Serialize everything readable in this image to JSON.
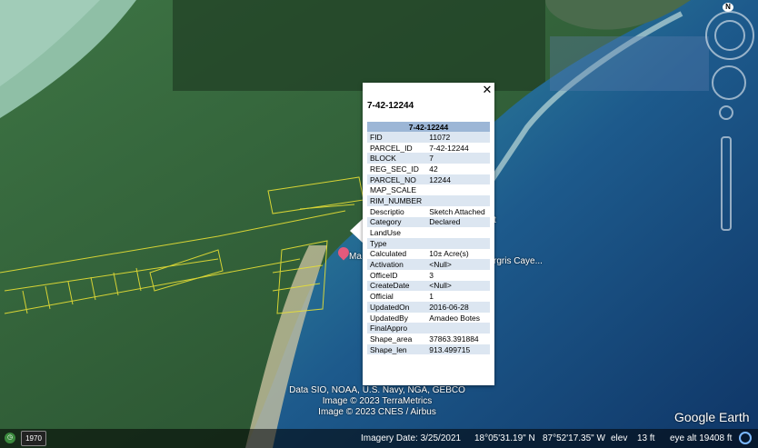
{
  "popup": {
    "title": "7-42-12244",
    "header": "7-42-12244",
    "rows": [
      {
        "key": "FID",
        "value": "11072"
      },
      {
        "key": "PARCEL_ID",
        "value": "7-42-12244"
      },
      {
        "key": "BLOCK",
        "value": "7"
      },
      {
        "key": "REG_SEC_ID",
        "value": "42"
      },
      {
        "key": "PARCEL_NO",
        "value": "12244"
      },
      {
        "key": "MAP_SCALE",
        "value": ""
      },
      {
        "key": "RIM_NUMBER",
        "value": ""
      },
      {
        "key": "Descriptio",
        "value": "Sketch Attached"
      },
      {
        "key": "Category",
        "value": "Declared"
      },
      {
        "key": "LandUse",
        "value": ""
      },
      {
        "key": "Type",
        "value": ""
      },
      {
        "key": "Calculated",
        "value": "10± Acre(s)"
      },
      {
        "key": "Activation",
        "value": "<Null>"
      },
      {
        "key": "OfficeID",
        "value": "3"
      },
      {
        "key": "CreateDate",
        "value": "<Null>"
      },
      {
        "key": "Official",
        "value": "1"
      },
      {
        "key": "UpdatedOn",
        "value": "2016-06-28"
      },
      {
        "key": "UpdatedBy",
        "value": "Amadeo Botes"
      },
      {
        "key": "FinalAppro",
        "value": ""
      },
      {
        "key": "Shape_area",
        "value": "37863.391884"
      },
      {
        "key": "Shape_len",
        "value": "913.499715"
      }
    ]
  },
  "map": {
    "place_label_left": "Ma",
    "place_label_right": "rgris Caye...",
    "place_label_t": "t",
    "credits": [
      "Data SIO, NOAA, U.S. Navy, NGA, GEBCO",
      "Image © 2023 TerraMetrics",
      "Image © 2023 CNES / Airbus"
    ],
    "logo": "Google Earth",
    "compass_north": "N"
  },
  "status": {
    "year": "1970",
    "imagery_date": "Imagery Date: 3/25/2021",
    "lat": "18°05'31.19\" N",
    "lon": "87°52'17.35\" W",
    "elev_label": "elev",
    "elev_value": "13 ft",
    "eye_alt": "eye alt  19408 ft"
  },
  "colors": {
    "table_header": "#9cb6d6",
    "table_row_alt": "#dce6f1",
    "parcel_lines": "#e8e035"
  }
}
